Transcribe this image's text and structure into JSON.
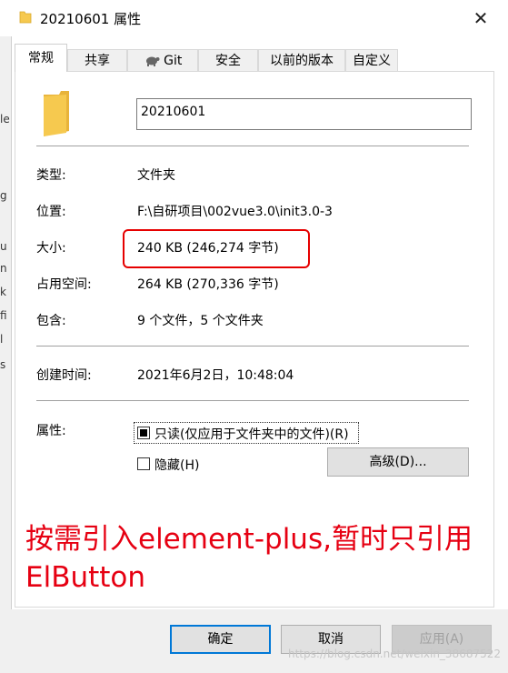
{
  "window": {
    "title": "20210601 属性",
    "close_glyph": "✕"
  },
  "background_text": [
    "le",
    "g",
    "u",
    "n",
    "k",
    "fi",
    "l",
    "s"
  ],
  "tabs": [
    "常规",
    "共享",
    "Git",
    "安全",
    "以前的版本",
    "自定义"
  ],
  "general": {
    "name_value": "20210601",
    "rows": [
      {
        "label": "类型:",
        "value": "文件夹"
      },
      {
        "label": "位置:",
        "value": "F:\\自研项目\\002vue3.0\\init3.0-3"
      },
      {
        "label": "大小:",
        "value": "240 KB (246,274 字节)"
      },
      {
        "label": "占用空间:",
        "value": "264 KB (270,336 字节)"
      },
      {
        "label": "包含:",
        "value": "9 个文件，5 个文件夹"
      },
      {
        "label": "创建时间:",
        "value": "2021年6月2日，10:48:04"
      }
    ],
    "attributes_label": "属性:",
    "readonly_label": "只读(仅应用于文件夹中的文件)(R)",
    "hidden_label": "隐藏(H)",
    "advanced_button": "高级(D)..."
  },
  "annotation": "按需引入element-plus,暂时只引用ElButton",
  "buttons": {
    "ok": "确定",
    "cancel": "取消",
    "apply": "应用(A)"
  },
  "watermark": "https://blog.csdn.net/weixin_38687522",
  "colors": {
    "highlight": "#e60000",
    "annotation": "#e60012",
    "folder": "#f6c94f"
  }
}
